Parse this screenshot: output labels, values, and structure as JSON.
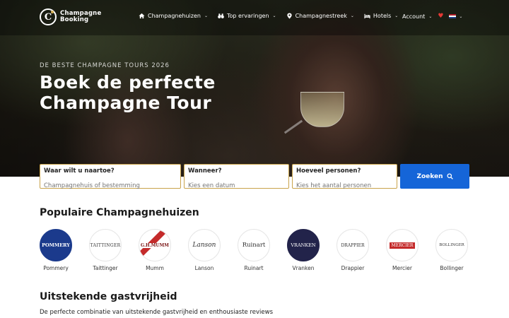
{
  "brand": {
    "line1": "Champagne",
    "line2": "Booking",
    "mark": "C"
  },
  "nav": {
    "items": [
      {
        "label": "Champagnehuizen",
        "icon": "house-icon"
      },
      {
        "label": "Top ervaringen",
        "icon": "binoculars-icon"
      },
      {
        "label": "Champagnestreek",
        "icon": "map-pin-icon"
      },
      {
        "label": "Hotels",
        "icon": "bed-icon"
      }
    ],
    "account_label": "Account"
  },
  "hero": {
    "subtitle": "DE BESTE CHAMPAGNE TOURS 2026",
    "title_line1": "Boek de perfecte",
    "title_line2": "Champagne Tour"
  },
  "search": {
    "destination": {
      "label": "Waar wilt u naartoe?",
      "placeholder": "Champagnehuis of bestemming"
    },
    "date": {
      "label": "Wanneer?",
      "placeholder": "Kies een datum"
    },
    "persons": {
      "label": "Hoeveel personen?",
      "placeholder": "Kies het aantal personen"
    },
    "button_label": "Zoeken"
  },
  "popular": {
    "heading": "Populaire Champagnehuizen",
    "houses": [
      {
        "name": "Pommery",
        "logo_text": "POMMERY"
      },
      {
        "name": "Taittinger",
        "logo_text": "TAITTINGER"
      },
      {
        "name": "Mumm",
        "logo_text": "G.H.MUMM"
      },
      {
        "name": "Lanson",
        "logo_text": "Lanson"
      },
      {
        "name": "Ruinart",
        "logo_text": "Ruinart"
      },
      {
        "name": "Vranken",
        "logo_text": "VRANKEN"
      },
      {
        "name": "Drappier",
        "logo_text": "DRAPPIER"
      },
      {
        "name": "Mercier",
        "logo_text": "MERCIER"
      },
      {
        "name": "Bollinger",
        "logo_text": "BOLLINGER"
      }
    ]
  },
  "hospitality": {
    "heading": "Uitstekende gastvrijheid",
    "description": "De perfecte combinatie van uitstekende gastvrijheid en enthousiaste reviews"
  },
  "colors": {
    "accent": "#1565d8",
    "gold": "#c9a34a",
    "pommery_blue": "#1b3a8c",
    "vranken_navy": "#22234a",
    "mercier_red": "#c42a2a"
  }
}
